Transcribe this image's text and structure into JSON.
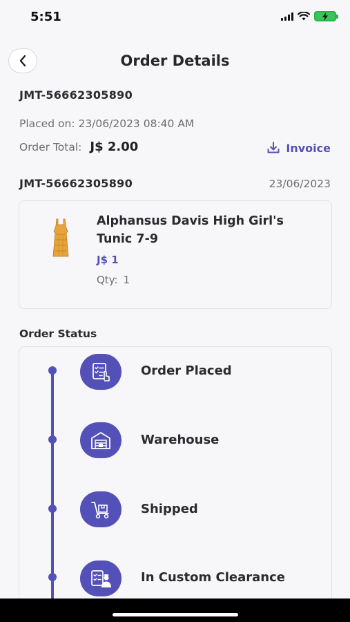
{
  "status_bar": {
    "time": "5:51"
  },
  "header": {
    "title": "Order Details"
  },
  "order": {
    "id": "JMT-56662305890",
    "placed_label": "Placed on:",
    "placed_value": "23/06/2023 08:40 AM",
    "total_label": "Order Total:",
    "total_value": "J$ 2.00",
    "invoice_label": "Invoice"
  },
  "sub_order": {
    "id": "JMT-56662305890",
    "date": "23/06/2023"
  },
  "product": {
    "name": "Alphansus Davis High Girl's Tunic 7-9",
    "price": "J$ 1",
    "qty_label": "Qty:",
    "qty_value": "1"
  },
  "order_status": {
    "heading": "Order Status",
    "steps": [
      {
        "label": "Order Placed",
        "icon": "checklist-icon"
      },
      {
        "label": "Warehouse",
        "icon": "warehouse-icon"
      },
      {
        "label": "Shipped",
        "icon": "hand-truck-icon"
      },
      {
        "label": "In Custom Clearance",
        "icon": "customs-icon"
      }
    ]
  },
  "colors": {
    "accent": "#5350b8",
    "text": "#2a2a2f",
    "muted": "#6c6c73"
  }
}
